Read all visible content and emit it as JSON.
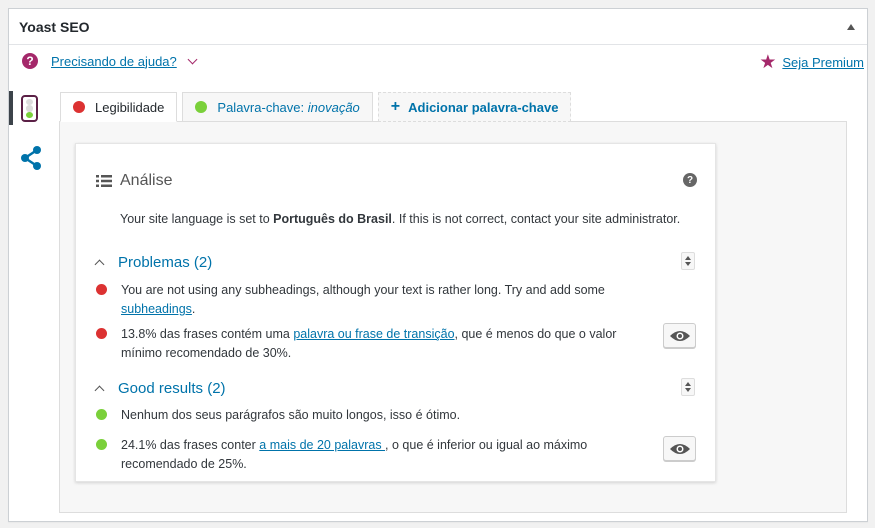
{
  "postbox": {
    "title": "Yoast SEO"
  },
  "help": {
    "label": "Precisando de ajuda?"
  },
  "premium": {
    "label": "Seja Premium"
  },
  "colors": {
    "red": "#dc3232",
    "green": "#7ad03a",
    "purple": "#a4286a",
    "link": "#0073aa",
    "gray": "#dcdcdc"
  },
  "icons": [
    "question-icon",
    "chevron-down-icon",
    "star-icon",
    "traffic-light-icon",
    "share-icon",
    "list-icon",
    "help-circle-icon",
    "eye-icon",
    "chevron-up-icon",
    "sort-icon",
    "plus-icon"
  ],
  "tabs": {
    "readability": "Legibilidade",
    "keyword_prefix": "Palavra-chave:",
    "keyword_value": "inovação",
    "add_keyword": "Adicionar palavra-chave"
  },
  "analysis": {
    "title": "Análise",
    "lang_prefix": "Your site language is set to ",
    "lang_name": "Português do Brasil",
    "lang_suffix": ". If this is not correct, contact your site administrator."
  },
  "problems": {
    "title": "Problemas (2)",
    "items": [
      {
        "pre": "You are not using any subheadings, although your text is rather long. Try and add some ",
        "link": "subheadings",
        "post": "."
      },
      {
        "pre": "13.8% das frases contém uma ",
        "link": "palavra ou frase de transição",
        "post": ", que é menos do que o valor mínimo recomendado de 30%."
      }
    ]
  },
  "good": {
    "title": "Good results (2)",
    "items": [
      {
        "pre": "Nenhum dos seus parágrafos são muito longos, isso é ótimo.",
        "link": "",
        "post": ""
      },
      {
        "pre": "24.1% das frases conter ",
        "link": "a mais de 20 palavras ",
        "post": ", o que é inferior ou igual ao máximo recomendado de 25%."
      }
    ]
  }
}
